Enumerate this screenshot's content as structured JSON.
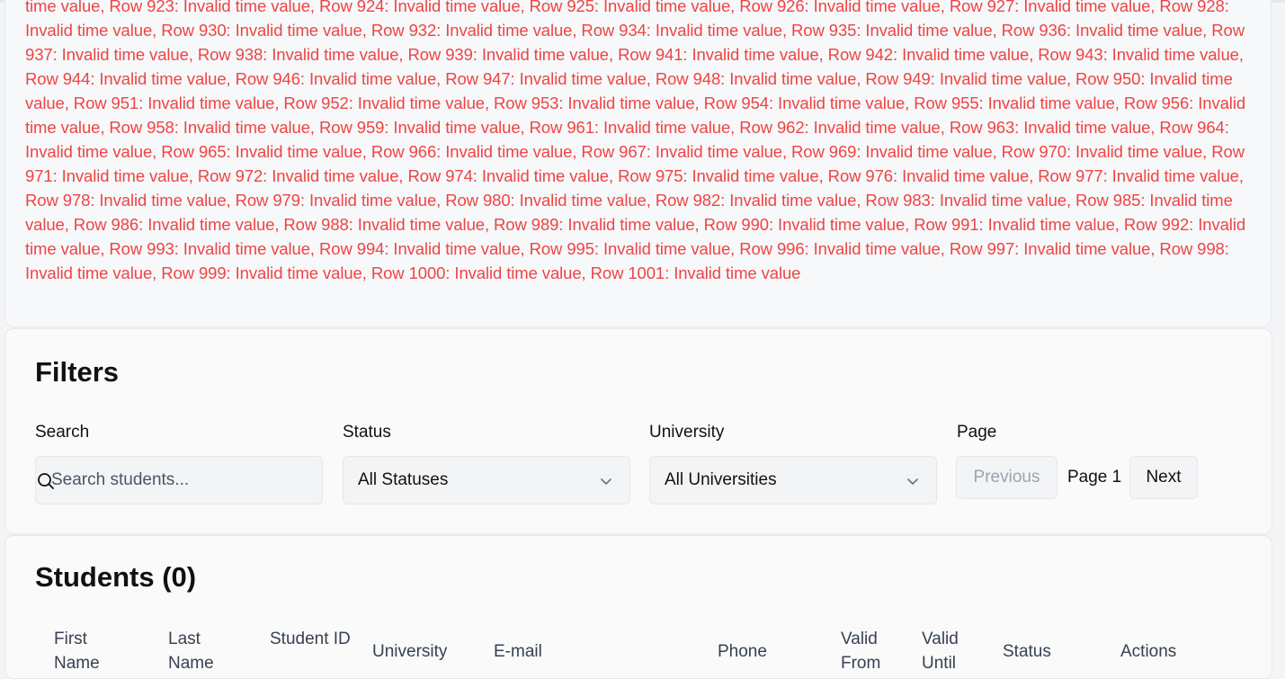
{
  "errors": {
    "text": "time value, Row 923: Invalid time value, Row 924: Invalid time value, Row 925: Invalid time value, Row 926: Invalid time value, Row 927: Invalid time value, Row 928: Invalid time value, Row 930: Invalid time value, Row 932: Invalid time value, Row 934: Invalid time value, Row 935: Invalid time value, Row 936: Invalid time value, Row 937: Invalid time value, Row 938: Invalid time value, Row 939: Invalid time value, Row 941: Invalid time value, Row 942: Invalid time value, Row 943: Invalid time value, Row 944: Invalid time value, Row 946: Invalid time value, Row 947: Invalid time value, Row 948: Invalid time value, Row 949: Invalid time value, Row 950: Invalid time value, Row 951: Invalid time value, Row 952: Invalid time value, Row 953: Invalid time value, Row 954: Invalid time value, Row 955: Invalid time value, Row 956: Invalid time value, Row 958: Invalid time value, Row 959: Invalid time value, Row 961: Invalid time value, Row 962: Invalid time value, Row 963: Invalid time value, Row 964: Invalid time value, Row 965: Invalid time value, Row 966: Invalid time value, Row 967: Invalid time value, Row 969: Invalid time value, Row 970: Invalid time value, Row 971: Invalid time value, Row 972: Invalid time value, Row 974: Invalid time value, Row 975: Invalid time value, Row 976: Invalid time value, Row 977: Invalid time value, Row 978: Invalid time value, Row 979: Invalid time value, Row 980: Invalid time value, Row 982: Invalid time value, Row 983: Invalid time value, Row 985: Invalid time value, Row 986: Invalid time value, Row 988: Invalid time value, Row 989: Invalid time value, Row 990: Invalid time value, Row 991: Invalid time value, Row 992: Invalid time value, Row 993: Invalid time value, Row 994: Invalid time value, Row 995: Invalid time value, Row 996: Invalid time value, Row 997: Invalid time value, Row 998: Invalid time value, Row 999: Invalid time value, Row 1000: Invalid time value, Row 1001: Invalid time value",
    "color": "#ef4444"
  },
  "filters": {
    "title": "Filters",
    "search_label": "Search",
    "search_placeholder": "Search students...",
    "search_icon": "search-icon",
    "status_label": "Status",
    "status_value": "All Statuses",
    "university_label": "University",
    "university_value": "All Universities",
    "page_label": "Page",
    "prev_label": "Previous",
    "page_indicator": "Page 1",
    "next_label": "Next"
  },
  "students": {
    "title": "Students (0)",
    "columns": [
      "First Name",
      "Last Name",
      "Student ID",
      "University",
      "E-mail",
      "Phone",
      "Valid From",
      "Valid Until",
      "Status",
      "Actions"
    ]
  },
  "colors": {
    "accent": "#2563eb",
    "error": "#ef4444",
    "card_bg": "#fafafa",
    "control_bg": "#f3f4f6"
  }
}
